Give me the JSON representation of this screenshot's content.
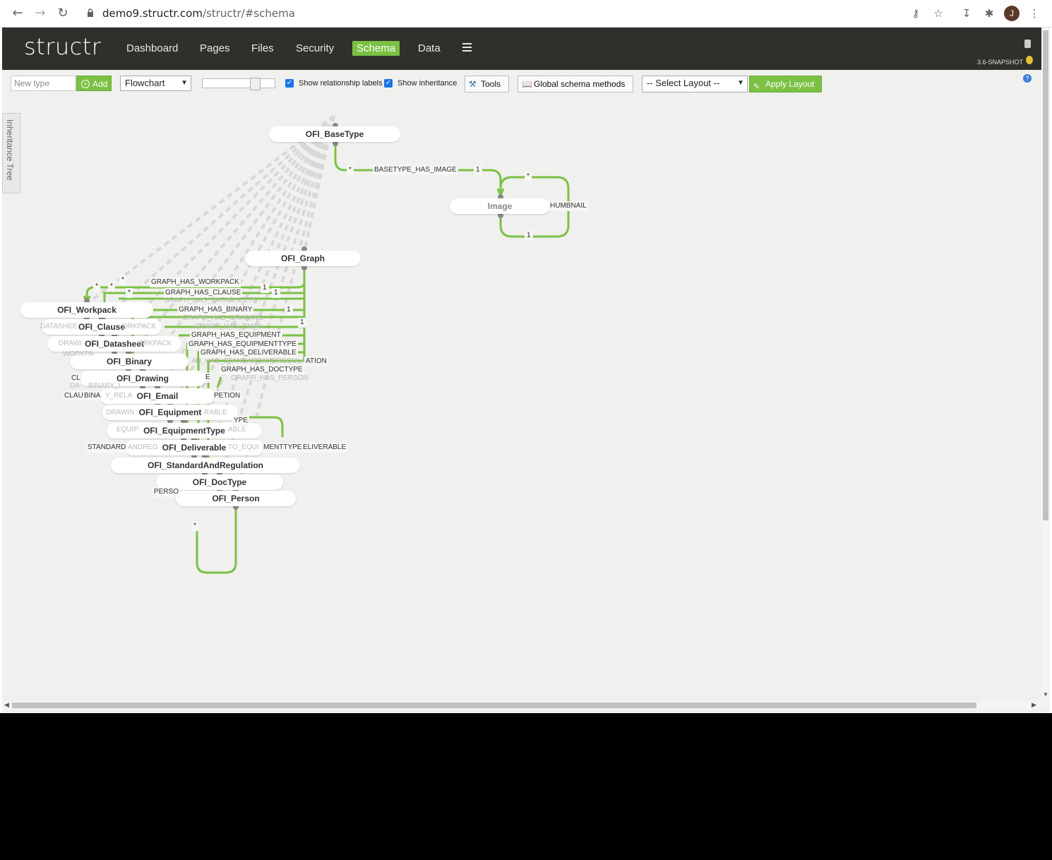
{
  "browser": {
    "url_host": "demo9.structr.com",
    "url_path": "/structr/#schema",
    "avatar_letter": "J"
  },
  "header": {
    "logo": "structr",
    "menu": [
      "Dashboard",
      "Pages",
      "Files",
      "Security",
      "Schema",
      "Data"
    ],
    "active": "Schema",
    "version": "3.6-SNAPSHOT"
  },
  "toolbar": {
    "new_type_placeholder": "New type",
    "add_label": "Add",
    "connector_select": "Flowchart",
    "zoom_level": 0.75,
    "show_rel_labels": "Show relationship labels",
    "show_inheritance": "Show inheritance",
    "tools_label": "Tools",
    "global_methods_label": "Global schema methods",
    "layout_select": "-- Select Layout --",
    "apply_layout_label": "Apply Layout"
  },
  "sidebar": {
    "inheritance_tree": "Inheritance Tree"
  },
  "schema": {
    "nodes": [
      "OFI_BaseType",
      "Image",
      "OFI_Graph",
      "OFI_Workpack",
      "OFI_Clause",
      "OFI_Datasheet",
      "OFI_Binary",
      "OFI_Drawing",
      "OFI_Email",
      "OFI_Equipment",
      "OFI_EquipmentType",
      "OFI_Deliverable",
      "OFI_StandardAndRegulation",
      "OFI_DocType",
      "OFI_Person"
    ],
    "relationships": {
      "basetype_image": "BASETYPE_HAS_IMAGE",
      "thumbnail": "HUMBNAIL",
      "workpack": "GRAPH_HAS_WORKPACK",
      "clause": "GRAPH_HAS_CLAUSE",
      "datasheets": "GRAPH_HAS_DATASHEETS",
      "binary": "GRAPH_HAS_BINARY",
      "drawing": "GRAPH_HAS_DRAWING",
      "email": "GRAPH_HAS_EMAIL",
      "equipment": "GRAPH_HAS_EQUIPMENT",
      "equipmenttype": "GRAPH_HAS_EQUIPMENTTYPE",
      "deliverable": "GRAPH_HAS_DELIVERABLE",
      "standard": "AH_HAS_STANDARDANDREGULATION",
      "doctype": "GRAPH_HAS_DOCTYPE",
      "person": "GRAPH_HAS_PERSON",
      "partial_1": "DATASHEE",
      "partial_2": "ORKPACK",
      "partial_3": "DRAWI",
      "partial_4": "ORKPACK",
      "partial_5": "WORKPA",
      "partial_6": "CL",
      "partial_7": "DA",
      "partial_8": "BINARY_I",
      "partial_9": "CLAU",
      "partial_10": "BINA",
      "partial_11": "Y_RELA",
      "partial_12": "PETION",
      "partial_13": "DRAWIN",
      "partial_14": "RABLE",
      "partial_15": "EQUIP",
      "partial_16": "ABLE",
      "partial_17": "STANDARD",
      "partial_18": "ANDREG",
      "partial_19": "TO_EQUI",
      "partial_20": "MENTTYPE",
      "partial_21": "ELIVERABLE",
      "partial_22": "PERSO",
      "partial_23": "ATION",
      "partial_24": "YPE",
      "partial_25": "E"
    },
    "multiplicities": {
      "star": "*",
      "one": "1"
    }
  },
  "colors": {
    "accent": "#7bc144",
    "header_bg": "#2f2f2c",
    "canvas_bg": "#f0f0ee"
  }
}
